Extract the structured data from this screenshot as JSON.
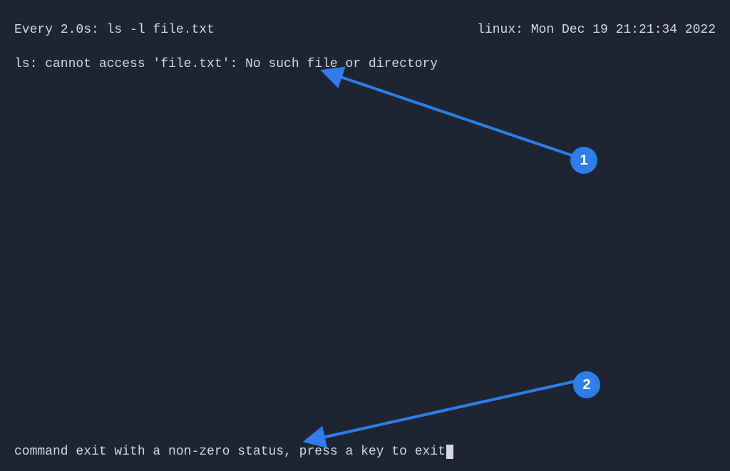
{
  "header": {
    "interval_text": "Every 2.0s: ls -l file.txt",
    "host_time": "linux: Mon Dec 19 21:21:34 2022"
  },
  "output": {
    "error_line": "ls: cannot access 'file.txt': No such file or directory"
  },
  "bottom": {
    "status_line": "command exit with a non-zero status, press a key to exit"
  },
  "annotations": {
    "badge1": "1",
    "badge2": "2"
  }
}
